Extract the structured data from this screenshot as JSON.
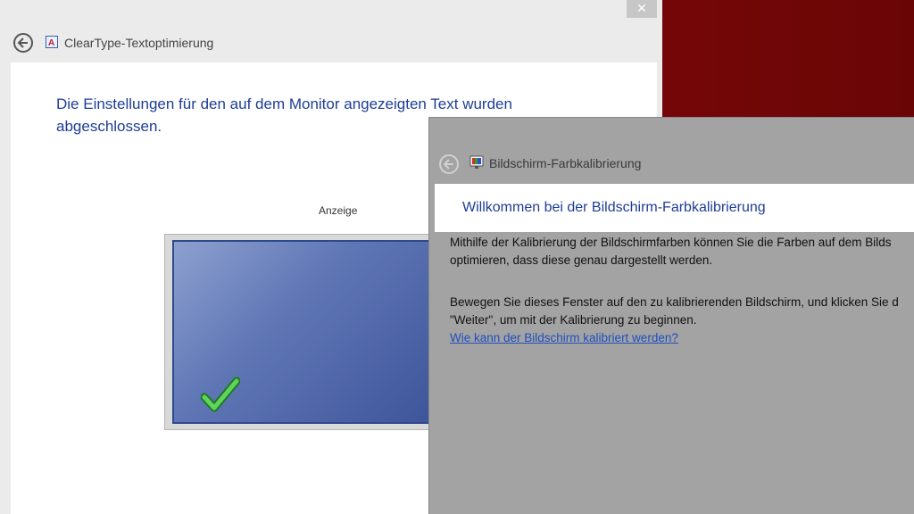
{
  "cleartype": {
    "close_glyph": "✕",
    "title": "ClearType-Textoptimierung",
    "heading": "Die Einstellungen für den auf dem Monitor angezeigten Text wurden abgeschlossen.",
    "display_label": "Anzeige",
    "icons": {
      "back": "back-arrow-icon",
      "app": "cleartype-icon",
      "status": "checkmark-icon"
    }
  },
  "calibration": {
    "title": "Bildschirm-Farbkalibrierung",
    "heading": "Willkommen bei der Bildschirm-Farbkalibrierung",
    "para1_line1": "Mithilfe der Kalibrierung der Bildschirmfarben können Sie die Farben auf dem Bilds",
    "para1_line2": "optimieren, dass diese genau dargestellt werden.",
    "para2_line1": "Bewegen Sie dieses Fenster auf den zu kalibrierenden Bildschirm, und klicken Sie d",
    "para2_line2": "\"Weiter\", um mit der Kalibrierung zu beginnen.",
    "help_link": "Wie kann der Bildschirm kalibriert werden?",
    "icons": {
      "back": "back-arrow-icon",
      "app": "color-calibration-icon"
    }
  },
  "colors": {
    "heading_blue": "#1e3d96",
    "link_blue": "#1f4fbf",
    "desktop_red": "#8c0a0c",
    "check_green": "#3aa53a"
  }
}
